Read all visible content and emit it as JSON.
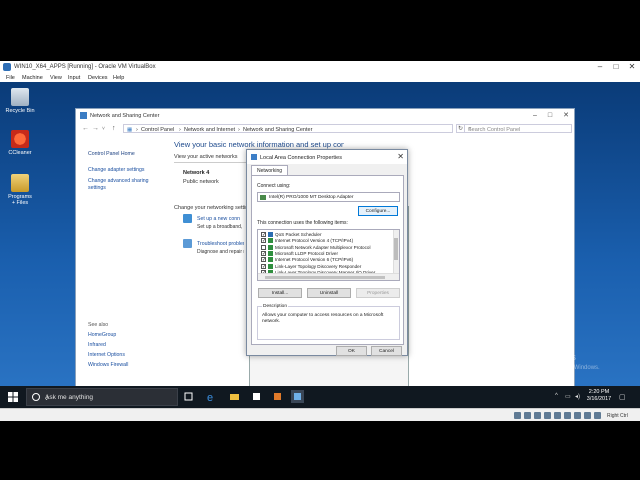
{
  "vbox": {
    "title": "WIN10_X64_APPS [Running] - Oracle VM VirtualBox",
    "menu": [
      "File",
      "Machine",
      "View",
      "Input",
      "Devices",
      "Help"
    ],
    "right_ctrl": "Right Ctrl"
  },
  "desktop_icons": [
    {
      "label": "Recycle Bin",
      "icon": "recycle-bin-icon"
    },
    {
      "label": "CCleaner",
      "icon": "ccleaner-icon"
    },
    {
      "label": "Programs + Files",
      "icon": "programs-files-icon"
    }
  ],
  "watermark": {
    "title": "Activate Windows",
    "subtitle": "Go to Settings to activate Windows."
  },
  "nsc": {
    "title": "Network and Sharing Center",
    "breadcrumb": [
      "Control Panel",
      "Network and Internet",
      "Network and Sharing Center"
    ],
    "search_placeholder": "Search Control Panel",
    "left_links": [
      "Control Panel Home",
      "Change adapter settings",
      "Change advanced sharing settings"
    ],
    "see_also_heading": "See also",
    "see_also": [
      "HomeGroup",
      "Infrared",
      "Internet Options",
      "Windows Firewall"
    ],
    "main_title": "View your basic network information and set up connections",
    "active_networks": "View your active networks",
    "network_name": "Network 4",
    "network_type": "Public network",
    "change_settings": "Change your networking settings",
    "setup_link": "Set up a new connection or network",
    "setup_desc": "Set up a broadband, dial-up, or VPN connection; or set up a router or access point.",
    "troubleshoot_link": "Troubleshoot problems",
    "troubleshoot_desc": "Diagnose and repair network problems, or get troubleshooting information."
  },
  "dialog": {
    "title": "Local Area Connection Properties",
    "tab": "Networking",
    "connect_using_label": "Connect using:",
    "adapter": "Intel(R) PRO/1000 MT Desktop Adapter",
    "configure": "Configure...",
    "items_label": "This connection uses the following items:",
    "items": [
      {
        "label": "QoS Packet Scheduler",
        "checked": true,
        "icon_color": "#2b6cb0"
      },
      {
        "label": "Internet Protocol Version 4 (TCP/IPv4)",
        "checked": true,
        "icon_color": "#2f8f3f"
      },
      {
        "label": "Microsoft Network Adapter Multiplexor Protocol",
        "checked": false,
        "icon_color": "#2f8f3f"
      },
      {
        "label": "Microsoft LLDP Protocol Driver",
        "checked": true,
        "icon_color": "#2f8f3f"
      },
      {
        "label": "Internet Protocol Version 6 (TCP/IPv6)",
        "checked": true,
        "icon_color": "#2f8f3f"
      },
      {
        "label": "Link-Layer Topology Discovery Responder",
        "checked": true,
        "icon_color": "#2f8f3f"
      },
      {
        "label": "Link-Layer Topology Discovery Mapper I/O Driver",
        "checked": true,
        "icon_color": "#2f8f3f"
      }
    ],
    "install": "Install...",
    "uninstall": "Uninstall",
    "properties": "Properties",
    "description_heading": "Description",
    "description": "Allows your computer to access resources on a Microsoft network.",
    "ok": "OK",
    "cancel": "Cancel"
  },
  "taskbar": {
    "search_placeholder": "Ask me anything",
    "time": "2:20 PM",
    "date": "3/16/2017"
  }
}
